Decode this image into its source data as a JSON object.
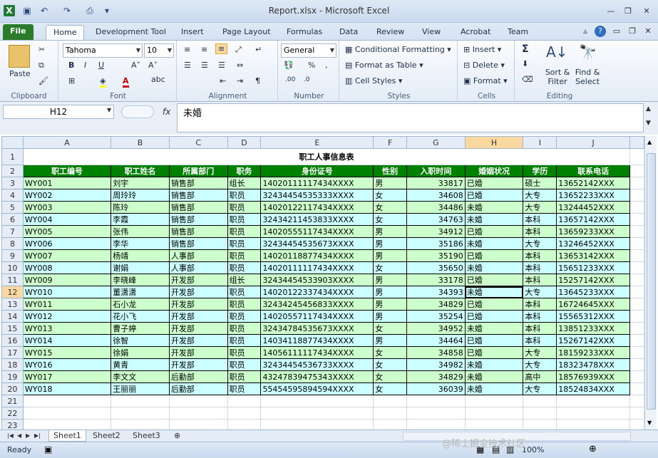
{
  "window": {
    "title": "Report.xlsx  -  Microsoft Excel"
  },
  "tabs": [
    "File",
    "Home",
    "Development Tool",
    "Insert",
    "Page Layout",
    "Formulas",
    "Data",
    "Review",
    "View",
    "Acrobat",
    "Team"
  ],
  "ribbon": {
    "clipboard": {
      "paste": "Paste",
      "label": "Clipboard"
    },
    "font": {
      "name": "Tahoma",
      "size": "10",
      "label": "Font",
      "bold": "B",
      "italic": "I",
      "underline": "U"
    },
    "alignment": {
      "label": "Alignment"
    },
    "number": {
      "format": "General",
      "label": "Number",
      "percent": "%",
      "comma": ","
    },
    "styles": {
      "conditional": "Conditional Formatting",
      "table": "Format as Table",
      "cell": "Cell Styles",
      "label": "Styles"
    },
    "cells": {
      "insert": "Insert",
      "delete": "Delete",
      "format": "Format",
      "label": "Cells"
    },
    "editing": {
      "sum": "Σ",
      "sort": "Sort & Filter",
      "find": "Find & Select",
      "label": "Editing"
    }
  },
  "formula_bar": {
    "name_box": "H12",
    "fx": "fx",
    "content": "未婚"
  },
  "columns": [
    "A",
    "B",
    "C",
    "D",
    "E",
    "F",
    "G",
    "H",
    "I",
    "J"
  ],
  "sheet": {
    "title": "职工人事信息表",
    "headers": [
      "职工编号",
      "职工姓名",
      "所属部门",
      "职务",
      "身份证号",
      "性别",
      "入职时间",
      "婚姻状况",
      "学历",
      "联系电话"
    ],
    "rows": [
      [
        "WY001",
        "刘宇",
        "销售部",
        "组长",
        "14020111117434XXXX",
        "男",
        "33817",
        "已婚",
        "硕士",
        "13652142XXX"
      ],
      [
        "WY002",
        "周玲玲",
        "销售部",
        "职员",
        "32434454535333XXXX",
        "女",
        "34608",
        "已婚",
        "大专",
        "13652233XXX"
      ],
      [
        "WY003",
        "陈玲",
        "销售部",
        "职员",
        "14020122117434XXXX",
        "女",
        "34486",
        "未婚",
        "大专",
        "13244452XXX"
      ],
      [
        "WY004",
        "李霞",
        "销售部",
        "职员",
        "32434211453833XXXX",
        "女",
        "34763",
        "未婚",
        "本科",
        "13657142XXX"
      ],
      [
        "WY005",
        "张伟",
        "销售部",
        "职员",
        "14020555117434XXXX",
        "男",
        "34912",
        "已婚",
        "本科",
        "13659233XXX"
      ],
      [
        "WY006",
        "李华",
        "销售部",
        "职员",
        "32434454535673XXXX",
        "男",
        "35186",
        "未婚",
        "大专",
        "13246452XXX"
      ],
      [
        "WY007",
        "杨靖",
        "人事部",
        "职员",
        "14020118877434XXXX",
        "男",
        "35190",
        "已婚",
        "本科",
        "13653142XXX"
      ],
      [
        "WY008",
        "谢娟",
        "人事部",
        "职员",
        "14020111117434XXXX",
        "女",
        "35650",
        "未婚",
        "本科",
        "15651233XXX"
      ],
      [
        "WY009",
        "李晓峰",
        "开发部",
        "组长",
        "32434454533903XXXX",
        "男",
        "33178",
        "已婚",
        "本科",
        "15257142XXX"
      ],
      [
        "WY010",
        "董潇潇",
        "开发部",
        "职员",
        "14020122337434XXXX",
        "男",
        "34393",
        "未婚",
        "大专",
        "13645233XXX"
      ],
      [
        "WY011",
        "石小龙",
        "开发部",
        "职员",
        "32434245456833XXXX",
        "男",
        "34829",
        "已婚",
        "本科",
        "16724645XXX"
      ],
      [
        "WY012",
        "花小飞",
        "开发部",
        "职员",
        "14020557117434XXXX",
        "男",
        "35254",
        "已婚",
        "本科",
        "15565312XXX"
      ],
      [
        "WY013",
        "曹子婷",
        "开发部",
        "职员",
        "32434784535673XXXX",
        "女",
        "34952",
        "未婚",
        "本科",
        "13851233XXX"
      ],
      [
        "WY014",
        "徐智",
        "开发部",
        "职员",
        "14034118877434XXXX",
        "男",
        "34464",
        "已婚",
        "本科",
        "15267142XXX"
      ],
      [
        "WY015",
        "徐娟",
        "开发部",
        "职员",
        "14056111117434XXXX",
        "女",
        "34858",
        "已婚",
        "大专",
        "18159233XXX"
      ],
      [
        "WY016",
        "黄青",
        "开发部",
        "职员",
        "32434454536733XXXX",
        "女",
        "34982",
        "未婚",
        "大专",
        "18323478XXX"
      ],
      [
        "WY017",
        "李文文",
        "后勤部",
        "职员",
        "43247839475343XXXX",
        "女",
        "34829",
        "未婚",
        "高中",
        "18576939XXX"
      ],
      [
        "WY018",
        "王丽丽",
        "后勤部",
        "职员",
        "55454595894594XXXX",
        "女",
        "36039",
        "未婚",
        "大专",
        "18524834XXX"
      ]
    ]
  },
  "sheet_tabs": [
    "Sheet1",
    "Sheet2",
    "Sheet3"
  ],
  "status": {
    "ready": "Ready",
    "zoom": "100%"
  },
  "watermark": "@稀土掘金技术社区",
  "colors": {
    "header_green": "#008000",
    "row_green": "#ccffcc",
    "row_cyan": "#ccffff",
    "file_tab": "#2a7c2a"
  }
}
